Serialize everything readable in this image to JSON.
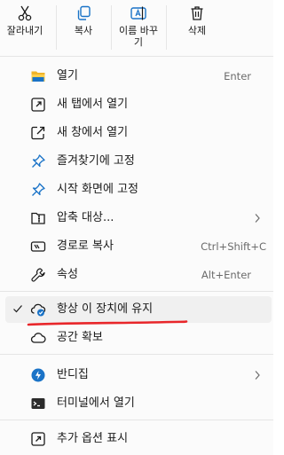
{
  "toolbar": {
    "cut_label": "잘라내기",
    "copy_label": "복사",
    "rename_label": "이름 바꾸\n기",
    "delete_label": "삭제"
  },
  "menu": {
    "open": {
      "label": "열기",
      "shortcut": "Enter"
    },
    "open_new_tab": {
      "label": "새 탭에서 열기"
    },
    "open_new_window": {
      "label": "새 창에서 열기"
    },
    "pin_quick_access": {
      "label": "즐겨찾기에 고정"
    },
    "pin_start": {
      "label": "시작 화면에 고정"
    },
    "compress": {
      "label": "압축 대상..."
    },
    "copy_path": {
      "label": "경로로 복사",
      "shortcut": "Ctrl+Shift+C"
    },
    "properties": {
      "label": "속성",
      "shortcut": "Alt+Enter"
    },
    "keep_on_device": {
      "label": "항상 이 장치에 유지",
      "checked": true
    },
    "free_up_space": {
      "label": "공간 확보"
    },
    "bandizip": {
      "label": "반디집"
    },
    "open_terminal": {
      "label": "터미널에서 열기"
    },
    "more_options": {
      "label": "추가 옵션 표시"
    }
  },
  "colors": {
    "accent_blue": "#1a73c7",
    "folder_yellow": "#f0b429",
    "annotation_red": "#e8262a"
  },
  "icons": [
    "scissors-icon",
    "copy-icon",
    "rename-icon",
    "trash-icon",
    "folder-icon",
    "open-new-tab-icon",
    "open-new-window-icon",
    "pin-icon",
    "pin-icon",
    "zip-icon",
    "copy-path-icon",
    "wrench-icon",
    "cloud-check-icon",
    "cloud-icon",
    "bandizip-icon",
    "terminal-icon",
    "more-options-icon"
  ]
}
